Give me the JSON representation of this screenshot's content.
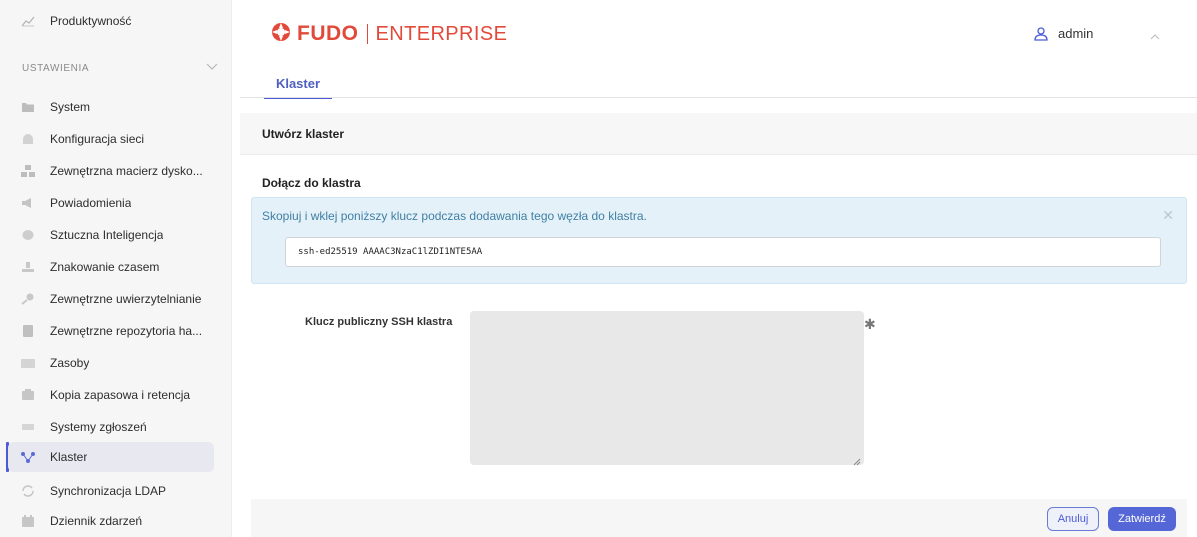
{
  "sidebar": {
    "top_item": "Produktywność",
    "section_label": "USTAWIENIA",
    "items": [
      {
        "label": "System",
        "icon": "folder-icon"
      },
      {
        "label": "Konfiguracja sieci",
        "icon": "network-icon"
      },
      {
        "label": "Zewnętrzna macierz dysko...",
        "icon": "storage-icon"
      },
      {
        "label": "Powiadomienia",
        "icon": "megaphone-icon"
      },
      {
        "label": "Sztuczna Inteligencja",
        "icon": "brain-icon"
      },
      {
        "label": "Znakowanie czasem",
        "icon": "timestamp-icon"
      },
      {
        "label": "Zewnętrzne uwierzytelnianie",
        "icon": "key-icon"
      },
      {
        "label": "Zewnętrzne repozytoria ha...",
        "icon": "book-icon"
      },
      {
        "label": "Zasoby",
        "icon": "resources-icon"
      },
      {
        "label": "Kopia zapasowa i retencja",
        "icon": "backup-icon"
      },
      {
        "label": "Systemy zgłoszeń",
        "icon": "tickets-icon"
      },
      {
        "label": "Klaster",
        "icon": "cluster-icon",
        "active": true
      },
      {
        "label": "Synchronizacja LDAP",
        "icon": "sync-icon"
      },
      {
        "label": "Dziennik zdarzeń",
        "icon": "calendar-icon"
      }
    ]
  },
  "header": {
    "logo_brand": "FUDO",
    "logo_product": "ENTERPRISE",
    "user_name": "admin"
  },
  "tabs": [
    {
      "label": "Klaster",
      "active": true
    }
  ],
  "create_panel": {
    "title": "Utwórz klaster"
  },
  "join_panel": {
    "title": "Dołącz do klastra",
    "alert_message": "Skopiuj i wklej poniższy klucz podczas dodawania tego węzła do klastra.",
    "ssh_key": "ssh-ed25519 AAAAC3NzaC1lZDI1NTE5AA",
    "field_label": "Klucz publiczny SSH klastra",
    "field_value": "",
    "required_mark": "✱"
  },
  "buttons": {
    "cancel": "Anuluj",
    "submit": "Zatwierdź"
  },
  "colors": {
    "accent": "#4a5bd4",
    "brand": "#e14a3a",
    "alert_bg": "#e5f1f8",
    "alert_text": "#3f7fa4"
  }
}
